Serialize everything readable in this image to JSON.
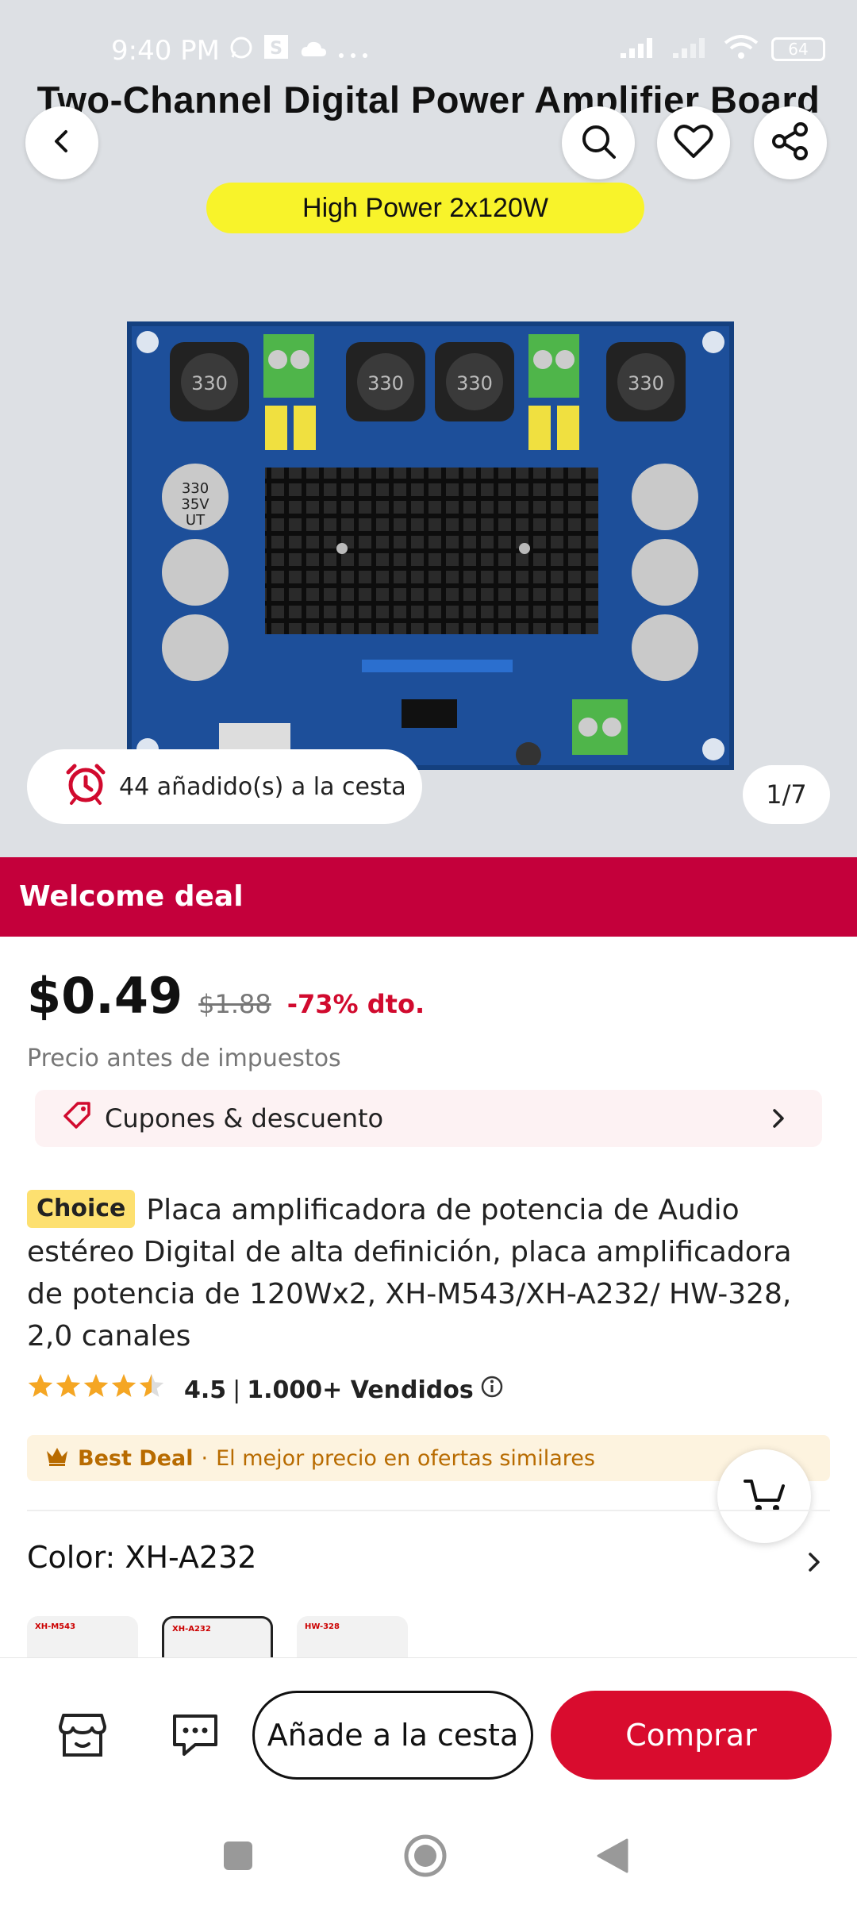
{
  "status_bar": {
    "time": "9:40 PM",
    "battery": "64"
  },
  "hero": {
    "title": "Two-Channel Digital Power Amplifier Board",
    "badge": "High Power 2x120W",
    "added_text": "44 añadido(s) a la cesta",
    "counter": "1/7",
    "capacitor_label": [
      "330",
      "35V",
      "UT"
    ],
    "choke_label": "330"
  },
  "deal_banner": "Welcome deal",
  "pricing": {
    "price": "$0.49",
    "original_price": "$1.88",
    "discount": "-73% dto.",
    "tax_note": "Precio antes de impuestos"
  },
  "coupon": {
    "label": "Cupones & descuento"
  },
  "product": {
    "badge": "Choice",
    "title": "Placa amplificadora de potencia de Audio estéreo Digital de alta definición, placa amplificadora de potencia de 120Wx2, XH-M543/XH-A232/ HW-328, 2,0 canales"
  },
  "rating": {
    "value": 4.5,
    "value_text": "4.5",
    "sold": "1.000+ Vendidos"
  },
  "best_deal": {
    "label": "Best Deal",
    "text": "El mejor precio en ofertas similares"
  },
  "variant": {
    "label": "Color: XH-A232",
    "thumbs": [
      "XH-M543",
      "XH-A232",
      "HW-328"
    ],
    "selected_index": 1
  },
  "actions": {
    "add_to_cart": "Añade a la cesta",
    "buy": "Comprar"
  },
  "colors": {
    "accent": "#d90c2e",
    "banner": "#c4003b",
    "badge_yellow": "#f8f32a",
    "star": "#f5a623"
  }
}
